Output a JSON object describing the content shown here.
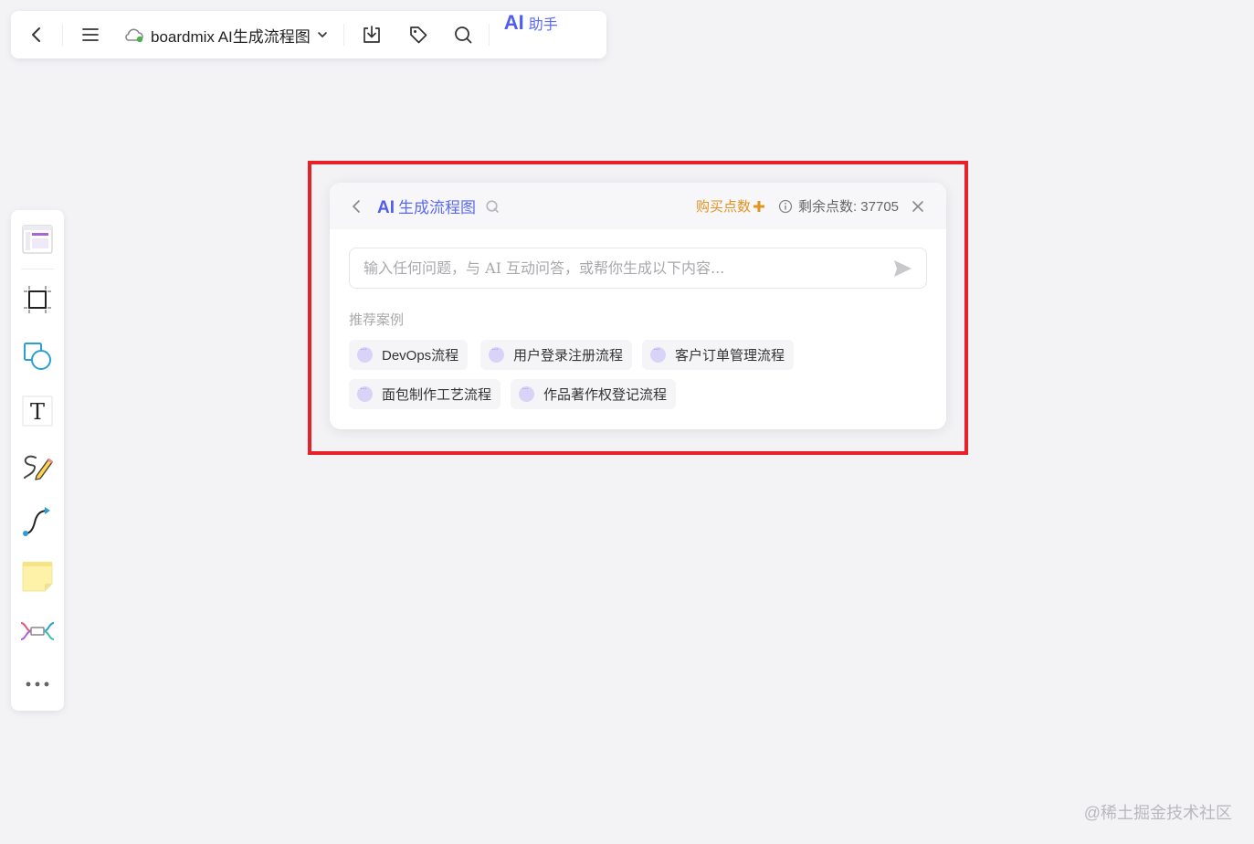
{
  "topbar": {
    "doc_title": "boardmix AI生成流程图",
    "ai_label": "AI",
    "assistant_label": "助手",
    "icons": [
      "back-icon",
      "menu-icon",
      "cloud-sync-icon",
      "chevron-down-icon",
      "download-icon",
      "tag-icon",
      "search-icon"
    ]
  },
  "sidebar": {
    "tools": [
      "template-icon",
      "frame-icon",
      "shape-icon",
      "text-icon",
      "pen-icon",
      "connector-icon",
      "sticky-note-icon",
      "mindmap-icon",
      "more-icon"
    ],
    "text_glyph": "T"
  },
  "panel": {
    "ai_label": "AI",
    "title": "生成流程图",
    "buy_label": "购买点数",
    "remaining_label": "剩余点数: 37705",
    "input_placeholder": "输入任何问题，与 AI 互动问答，或帮你生成以下内容...",
    "recommend_label": "推荐案例",
    "cases": [
      {
        "label": "DevOps流程"
      },
      {
        "label": "用户登录注册流程"
      },
      {
        "label": "客户订单管理流程"
      },
      {
        "label": "面包制作工艺流程"
      },
      {
        "label": "作品著作权登记流程"
      }
    ]
  },
  "watermark": "@稀土掘金技术社区",
  "colors": {
    "accent": "#4f5ef0",
    "highlight": "#e8202a",
    "buy": "#e39321",
    "sync": "#4caf50"
  }
}
